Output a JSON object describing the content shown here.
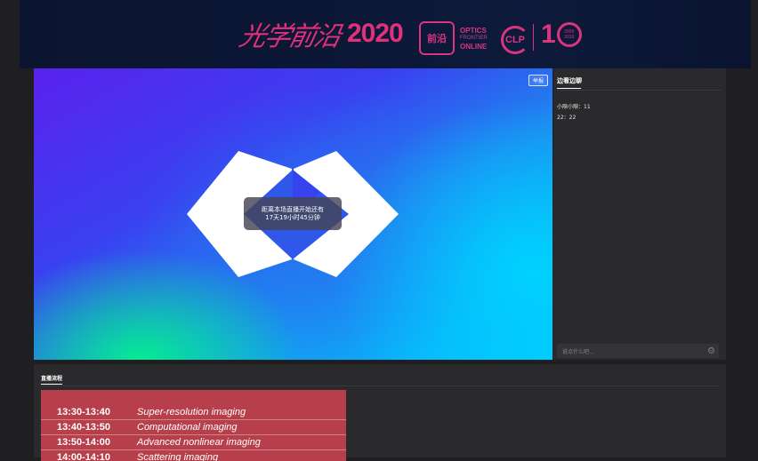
{
  "banner": {
    "calligraphy": "光学前沿",
    "year": "2020",
    "logo_of_badge": "前沿",
    "logo_of_lines": [
      "OPTICS",
      "FRONTIER",
      "ONLINE"
    ],
    "logo_clp": "CLP",
    "logo_ten": "1",
    "logo_ten_years": [
      "2009",
      "2019"
    ]
  },
  "video": {
    "report_label": "举报",
    "countdown_line1": "距离本场直播开始还有",
    "countdown_line2": "17天19小时45分钟"
  },
  "chat": {
    "title": "边看边聊",
    "messages": [
      "小隙小隙：11",
      "22：22"
    ],
    "input_placeholder": "说点什么吧…"
  },
  "schedule": {
    "tab_label": "直播流程",
    "items": [
      {
        "time": "13:30-13:40",
        "name": "Super-resolution imaging"
      },
      {
        "time": "13:40-13:50",
        "name": "Computational imaging"
      },
      {
        "time": "13:50-14:00",
        "name": "Advanced nonlinear imaging"
      },
      {
        "time": "14:00-14:10",
        "name": "Scattering imaging"
      }
    ]
  },
  "colors": {
    "brand_pink": "#e0317a",
    "agenda_red": "#b73f4b",
    "panel_bg": "#2a2a2c"
  }
}
